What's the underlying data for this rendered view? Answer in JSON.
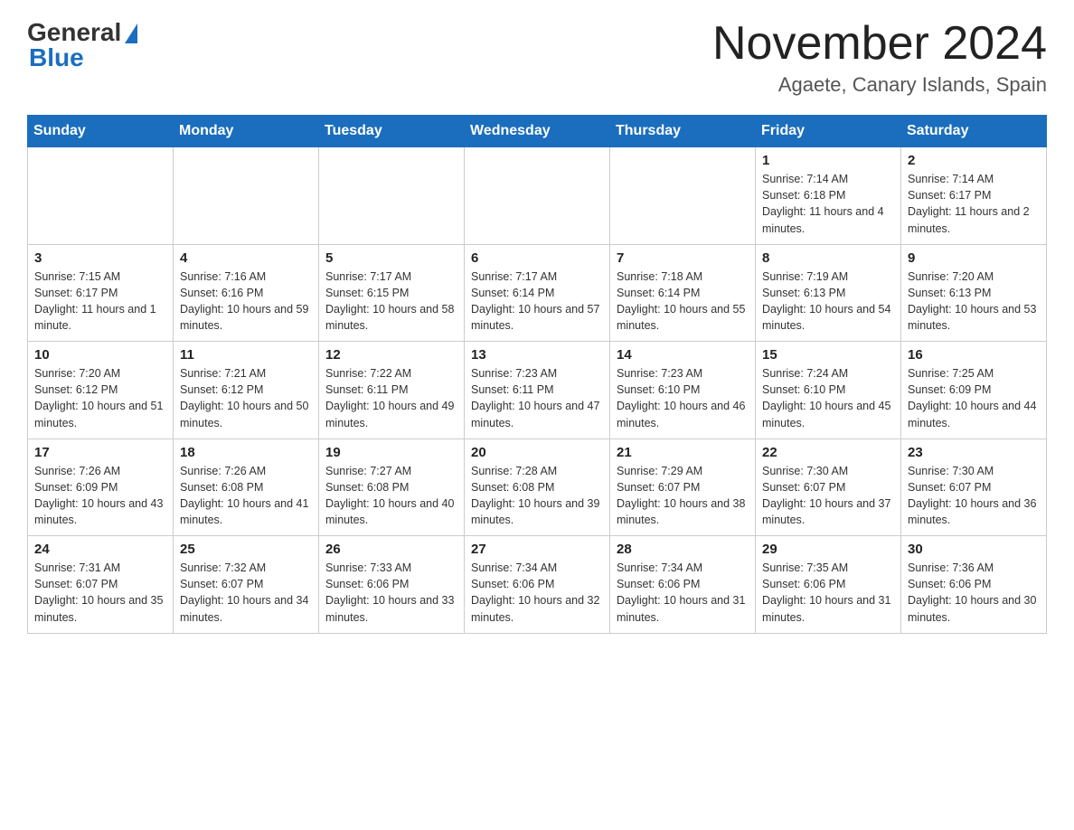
{
  "logo": {
    "general": "General",
    "blue": "Blue"
  },
  "title": "November 2024",
  "subtitle": "Agaete, Canary Islands, Spain",
  "days_of_week": [
    "Sunday",
    "Monday",
    "Tuesday",
    "Wednesday",
    "Thursday",
    "Friday",
    "Saturday"
  ],
  "weeks": [
    [
      {
        "day": "",
        "info": ""
      },
      {
        "day": "",
        "info": ""
      },
      {
        "day": "",
        "info": ""
      },
      {
        "day": "",
        "info": ""
      },
      {
        "day": "",
        "info": ""
      },
      {
        "day": "1",
        "info": "Sunrise: 7:14 AM\nSunset: 6:18 PM\nDaylight: 11 hours and 4 minutes."
      },
      {
        "day": "2",
        "info": "Sunrise: 7:14 AM\nSunset: 6:17 PM\nDaylight: 11 hours and 2 minutes."
      }
    ],
    [
      {
        "day": "3",
        "info": "Sunrise: 7:15 AM\nSunset: 6:17 PM\nDaylight: 11 hours and 1 minute."
      },
      {
        "day": "4",
        "info": "Sunrise: 7:16 AM\nSunset: 6:16 PM\nDaylight: 10 hours and 59 minutes."
      },
      {
        "day": "5",
        "info": "Sunrise: 7:17 AM\nSunset: 6:15 PM\nDaylight: 10 hours and 58 minutes."
      },
      {
        "day": "6",
        "info": "Sunrise: 7:17 AM\nSunset: 6:14 PM\nDaylight: 10 hours and 57 minutes."
      },
      {
        "day": "7",
        "info": "Sunrise: 7:18 AM\nSunset: 6:14 PM\nDaylight: 10 hours and 55 minutes."
      },
      {
        "day": "8",
        "info": "Sunrise: 7:19 AM\nSunset: 6:13 PM\nDaylight: 10 hours and 54 minutes."
      },
      {
        "day": "9",
        "info": "Sunrise: 7:20 AM\nSunset: 6:13 PM\nDaylight: 10 hours and 53 minutes."
      }
    ],
    [
      {
        "day": "10",
        "info": "Sunrise: 7:20 AM\nSunset: 6:12 PM\nDaylight: 10 hours and 51 minutes."
      },
      {
        "day": "11",
        "info": "Sunrise: 7:21 AM\nSunset: 6:12 PM\nDaylight: 10 hours and 50 minutes."
      },
      {
        "day": "12",
        "info": "Sunrise: 7:22 AM\nSunset: 6:11 PM\nDaylight: 10 hours and 49 minutes."
      },
      {
        "day": "13",
        "info": "Sunrise: 7:23 AM\nSunset: 6:11 PM\nDaylight: 10 hours and 47 minutes."
      },
      {
        "day": "14",
        "info": "Sunrise: 7:23 AM\nSunset: 6:10 PM\nDaylight: 10 hours and 46 minutes."
      },
      {
        "day": "15",
        "info": "Sunrise: 7:24 AM\nSunset: 6:10 PM\nDaylight: 10 hours and 45 minutes."
      },
      {
        "day": "16",
        "info": "Sunrise: 7:25 AM\nSunset: 6:09 PM\nDaylight: 10 hours and 44 minutes."
      }
    ],
    [
      {
        "day": "17",
        "info": "Sunrise: 7:26 AM\nSunset: 6:09 PM\nDaylight: 10 hours and 43 minutes."
      },
      {
        "day": "18",
        "info": "Sunrise: 7:26 AM\nSunset: 6:08 PM\nDaylight: 10 hours and 41 minutes."
      },
      {
        "day": "19",
        "info": "Sunrise: 7:27 AM\nSunset: 6:08 PM\nDaylight: 10 hours and 40 minutes."
      },
      {
        "day": "20",
        "info": "Sunrise: 7:28 AM\nSunset: 6:08 PM\nDaylight: 10 hours and 39 minutes."
      },
      {
        "day": "21",
        "info": "Sunrise: 7:29 AM\nSunset: 6:07 PM\nDaylight: 10 hours and 38 minutes."
      },
      {
        "day": "22",
        "info": "Sunrise: 7:30 AM\nSunset: 6:07 PM\nDaylight: 10 hours and 37 minutes."
      },
      {
        "day": "23",
        "info": "Sunrise: 7:30 AM\nSunset: 6:07 PM\nDaylight: 10 hours and 36 minutes."
      }
    ],
    [
      {
        "day": "24",
        "info": "Sunrise: 7:31 AM\nSunset: 6:07 PM\nDaylight: 10 hours and 35 minutes."
      },
      {
        "day": "25",
        "info": "Sunrise: 7:32 AM\nSunset: 6:07 PM\nDaylight: 10 hours and 34 minutes."
      },
      {
        "day": "26",
        "info": "Sunrise: 7:33 AM\nSunset: 6:06 PM\nDaylight: 10 hours and 33 minutes."
      },
      {
        "day": "27",
        "info": "Sunrise: 7:34 AM\nSunset: 6:06 PM\nDaylight: 10 hours and 32 minutes."
      },
      {
        "day": "28",
        "info": "Sunrise: 7:34 AM\nSunset: 6:06 PM\nDaylight: 10 hours and 31 minutes."
      },
      {
        "day": "29",
        "info": "Sunrise: 7:35 AM\nSunset: 6:06 PM\nDaylight: 10 hours and 31 minutes."
      },
      {
        "day": "30",
        "info": "Sunrise: 7:36 AM\nSunset: 6:06 PM\nDaylight: 10 hours and 30 minutes."
      }
    ]
  ]
}
